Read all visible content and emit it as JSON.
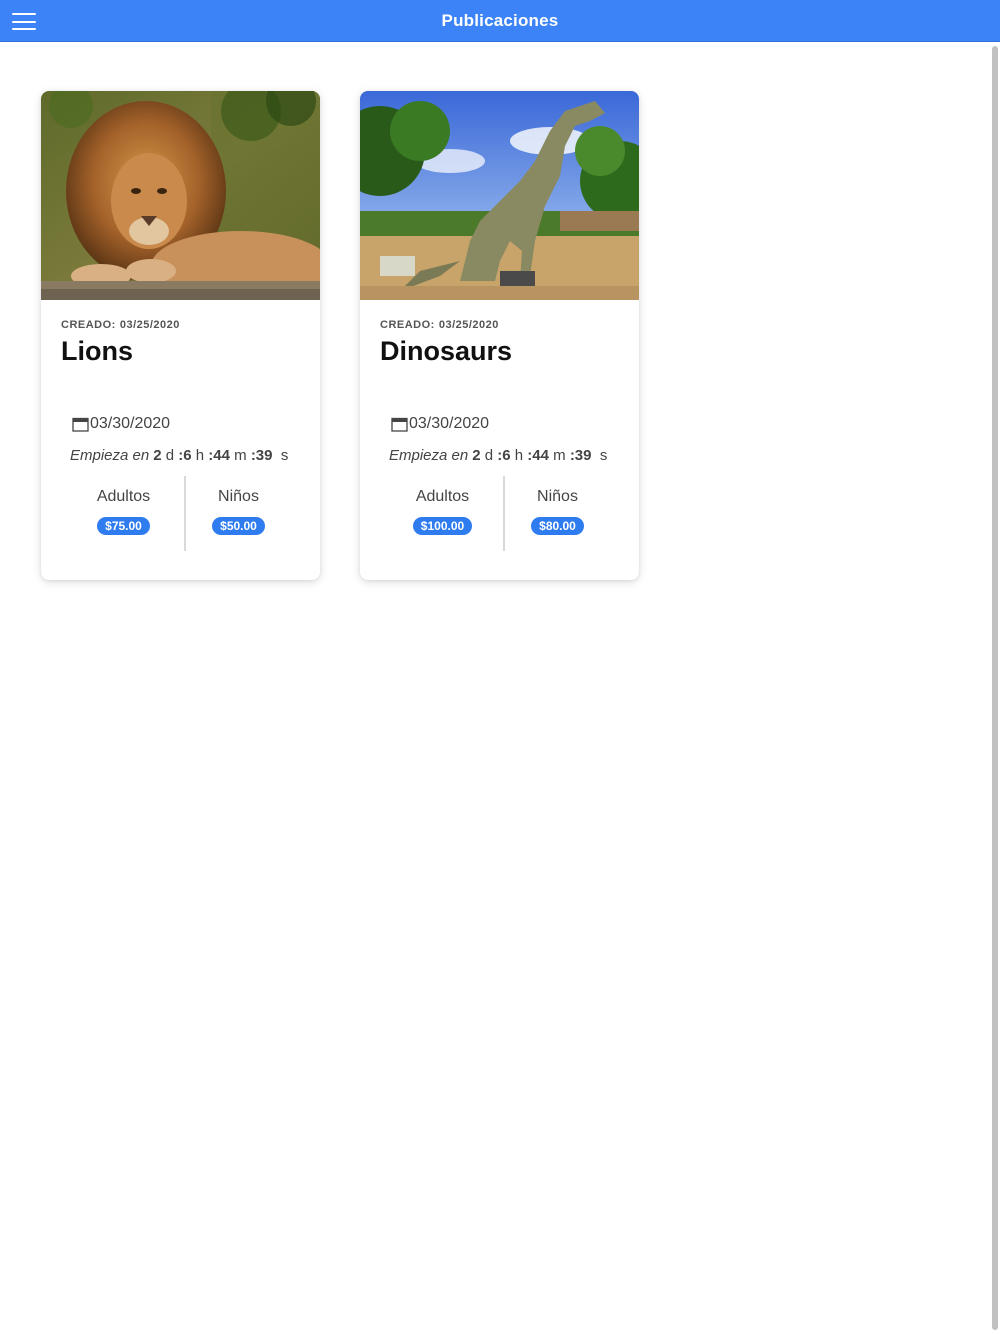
{
  "header": {
    "title": "Publicaciones",
    "menu_icon": "hamburger-menu-icon"
  },
  "colors": {
    "primary": "#3b83f6",
    "badge": "#2f7cf0"
  },
  "cards": [
    {
      "created_label": "CREADO:",
      "created_date": "03/25/2020",
      "title": "Lions",
      "image": "lion-photo",
      "date_icon": "calendar-icon",
      "event_date": "03/30/2020",
      "countdown_prefix": "Empieza en",
      "countdown_days": "2",
      "countdown_hours": ":6",
      "countdown_minutes": ":44",
      "countdown_seconds": ":39",
      "unit_d": "d",
      "unit_h": "h",
      "unit_m": "m",
      "unit_s": "s",
      "adults_label": "Adultos",
      "adults_price": "$75.00",
      "kids_label": "Niños",
      "kids_price": "$50.00"
    },
    {
      "created_label": "CREADO:",
      "created_date": "03/25/2020",
      "title": "Dinosaurs",
      "image": "dinosaur-photo",
      "date_icon": "calendar-icon",
      "event_date": "03/30/2020",
      "countdown_prefix": "Empieza en",
      "countdown_days": "2",
      "countdown_hours": ":6",
      "countdown_minutes": ":44",
      "countdown_seconds": ":39",
      "unit_d": "d",
      "unit_h": "h",
      "unit_m": "m",
      "unit_s": "s",
      "adults_label": "Adultos",
      "adults_price": "$100.00",
      "kids_label": "Niños",
      "kids_price": "$80.00"
    }
  ]
}
